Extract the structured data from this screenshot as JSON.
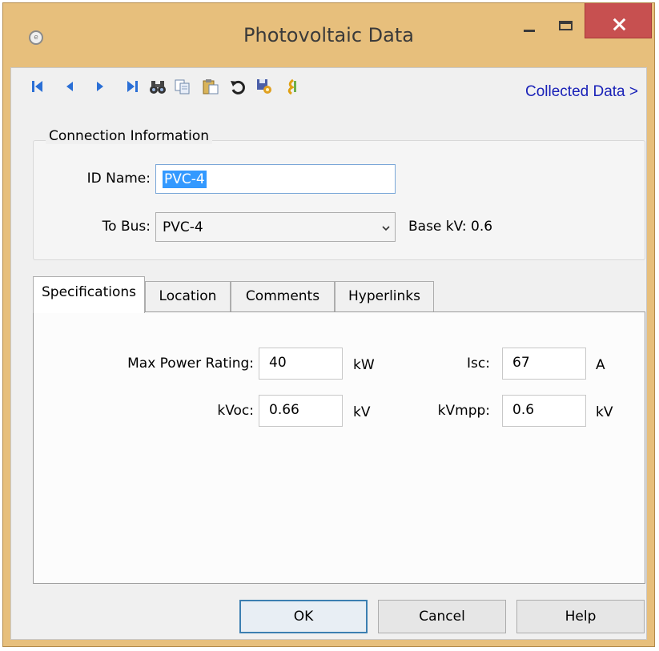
{
  "window": {
    "title": "Photovoltaic Data",
    "app_icon_glyph": "e"
  },
  "toolbar": {
    "icons": [
      "first-record-icon",
      "previous-record-icon",
      "next-record-icon",
      "last-record-icon",
      "find-icon",
      "copy-icon",
      "paste-icon",
      "undo-icon",
      "save-settings-icon",
      "wizard-icon"
    ],
    "collected_data_link": "Collected Data >"
  },
  "connection": {
    "group_label": "Connection Information",
    "id_name_label": "ID Name:",
    "id_name_value": "PVC-4",
    "to_bus_label": "To Bus:",
    "to_bus_value": "PVC-4",
    "base_kv_label": "Base kV: 0.6"
  },
  "tabs": [
    {
      "label": "Specifications",
      "active": true
    },
    {
      "label": "Location",
      "active": false
    },
    {
      "label": "Comments",
      "active": false
    },
    {
      "label": "Hyperlinks",
      "active": false
    }
  ],
  "specifications": {
    "max_power_label": "Max Power Rating:",
    "max_power_value": "40",
    "max_power_unit": "kW",
    "isc_label": "Isc:",
    "isc_value": "67",
    "isc_unit": "A",
    "kvoc_label": "kVoc:",
    "kvoc_value": "0.66",
    "kvoc_unit": "kV",
    "kvmpp_label": "kVmpp:",
    "kvmpp_value": "0.6",
    "kvmpp_unit": "kV"
  },
  "buttons": {
    "ok": "OK",
    "cancel": "Cancel",
    "help": "Help"
  },
  "colors": {
    "title_bar": "#e7bf7c",
    "close_button": "#c75050",
    "link": "#1a22b8",
    "selection": "#3399ff"
  }
}
